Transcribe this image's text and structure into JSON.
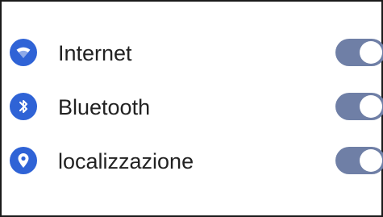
{
  "settings": {
    "items": [
      {
        "label": "Internet",
        "icon": "wifi-icon",
        "enabled": true
      },
      {
        "label": "Bluetooth",
        "icon": "bluetooth-icon",
        "enabled": true
      },
      {
        "label": "localizzazione",
        "icon": "location-pin-icon",
        "enabled": true
      }
    ]
  },
  "colors": {
    "icon_bg": "#2f63d6",
    "toggle_on": "#6f7fa6",
    "text": "#222222"
  }
}
